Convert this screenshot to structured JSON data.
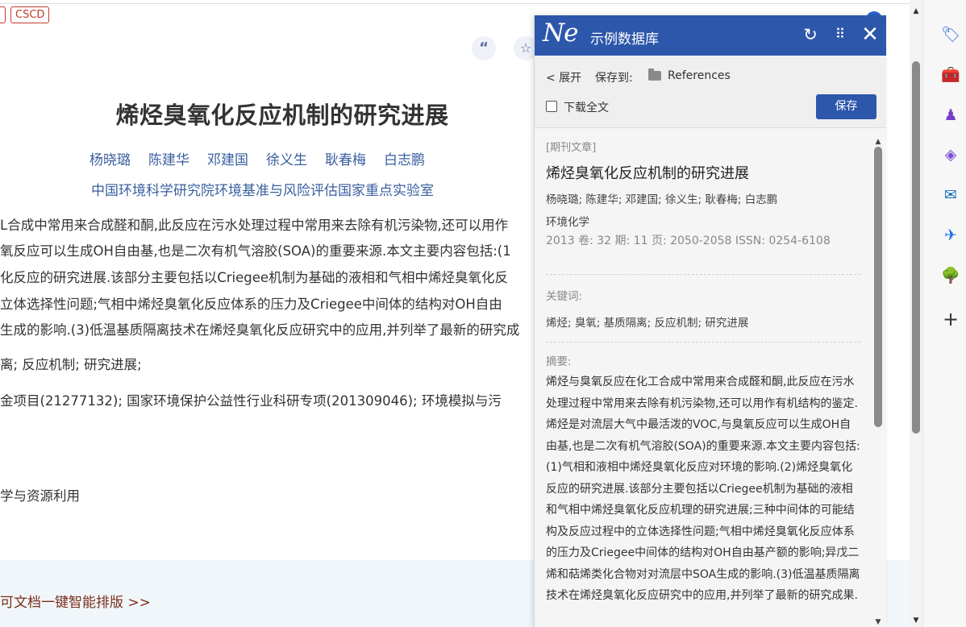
{
  "article": {
    "badge_partial": "]",
    "badge_cscd": "CSCD",
    "cite_icon": "“",
    "star_icon": "☆",
    "title": "烯烃臭氧化反应机制的研究进展",
    "authors": [
      "杨晓璐",
      "陈建华",
      "邓建国",
      "徐义生",
      "耿春梅",
      "白志鹏"
    ],
    "affiliation": "中国环境科学研究院环境基准与风险评估国家重点实验室",
    "abstract_lines": [
      "L合成中常用来合成醛和酮,此反应在污水处理过程中常用来去除有机污染物,还可以用作",
      "氧反应可以生成OH自由基,也是二次有机气溶胶(SOA)的重要来源.本文主要内容包括:(1",
      "化反应的研究进展.该部分主要包括以Criegee机制为基础的液相和气相中烯烃臭氧化反",
      "立体选择性问题;气相中烯烃臭氧化反应体系的压力及Criegee中间体的结构对OH自由",
      "生成的影响.(3)低温基质隔离技术在烯烃臭氧化反应研究中的应用,并列举了最新的研究成"
    ],
    "keywords_line": "离;  反应机制;  研究进展;",
    "funds_line": "金项目(21277132);   国家环境保护公益性行业科研专项(201309046);   环境模拟与污",
    "field_line": "学与资源利用",
    "promo_link": "可文档一键智能排版 >>"
  },
  "panel": {
    "logo": "Ne",
    "db_name": "示例数据库",
    "refresh_icon": "↻",
    "grid_icon": "⠿",
    "close_icon": "✕",
    "expand_label": "< 展开",
    "saveto_label": "保存到:",
    "folder_name": "References",
    "download_label": "下载全文",
    "save_button": "保存",
    "ref": {
      "type": "[期刊文章]",
      "title": "烯烃臭氧化反应机制的研究进展",
      "authors": "杨晓璐; 陈建华; 邓建国; 徐义生; 耿春梅; 白志鹏",
      "journal": "环境化学",
      "meta": "2013   卷: 32   期: 11   页: 2050-2058   ISSN: 0254-6108",
      "keywords_label": "关键词:",
      "keywords": "烯烃; 臭氧; 基质隔离; 反应机制; 研究进展",
      "abstract_label": "摘要:",
      "abstract": "烯烃与臭氧反应在化工合成中常用来合成醛和酮,此反应在污水处理过程中常用来去除有机污染物,还可以用作有机结构的鉴定.烯烃是对流层大气中最活泼的VOC,与臭氧反应可以生成OH自由基,也是二次有机气溶胶(SOA)的重要来源.本文主要内容包括:(1)气相和液相中烯烃臭氧化反应对环境的影响.(2)烯烃臭氧化反应的研究进展.该部分主要包括以Criegee机制为基础的液相和气相中烯烃臭氧化反应机理的研究进展;三种中间体的可能结构及反应过程中的立体选择性问题;气相中烯烃臭氧化反应体系的压力及Criegee中间体的结构对OH自由基产额的影响;异戊二烯和萜烯类化合物对对流层中SOA生成的影响.(3)低温基质隔离技术在烯烃臭氧化反应研究中的应用,并列举了最新的研究成果."
    }
  },
  "browser": {
    "scroll_up": "▲",
    "scroll_down": "▼",
    "sidebar_icons": [
      "🏷",
      "🧰",
      "♟",
      "◈",
      "✉",
      "✈",
      "🌳",
      "+"
    ]
  }
}
